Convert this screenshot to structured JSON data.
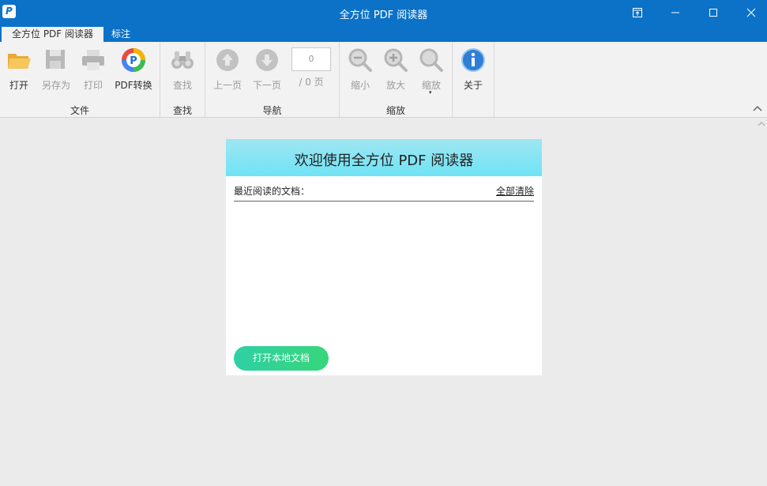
{
  "window": {
    "title": "全方位 PDF 阅读器",
    "icons": {
      "app": "pdf-reader-app-icon",
      "pin": "pin-icon",
      "minimize": "minimize-icon",
      "maximize": "maximize-icon",
      "close": "close-icon"
    }
  },
  "tabs": [
    {
      "label": "全方位 PDF 阅读器",
      "active": true
    },
    {
      "label": "标注",
      "active": false
    }
  ],
  "ribbon": {
    "groups": {
      "file": {
        "label": "文件",
        "buttons": [
          {
            "label": "打开",
            "icon": "folder-open-icon",
            "enabled": true
          },
          {
            "label": "另存为",
            "icon": "save-as-icon",
            "enabled": false
          },
          {
            "label": "打印",
            "icon": "printer-icon",
            "enabled": false
          },
          {
            "label": "PDF转换",
            "icon": "pdf-convert-icon",
            "enabled": true
          }
        ]
      },
      "find": {
        "label": "查找",
        "buttons": [
          {
            "label": "查找",
            "icon": "binoculars-icon",
            "enabled": false
          }
        ]
      },
      "nav": {
        "label": "导航",
        "buttons": [
          {
            "label": "上一页",
            "icon": "arrow-up-icon",
            "enabled": false
          },
          {
            "label": "下一页",
            "icon": "arrow-down-icon",
            "enabled": false
          }
        ],
        "page_input": "0",
        "page_total": "/ 0 页"
      },
      "zoom": {
        "label": "缩放",
        "buttons": [
          {
            "label": "缩小",
            "icon": "zoom-out-icon",
            "enabled": false
          },
          {
            "label": "放大",
            "icon": "zoom-in-icon",
            "enabled": false
          },
          {
            "label": "缩放",
            "icon": "zoom-icon",
            "enabled": false
          }
        ],
        "dropdown_arrow": "▾"
      },
      "about": {
        "buttons": [
          {
            "label": "关于",
            "icon": "info-icon",
            "enabled": true
          }
        ]
      }
    }
  },
  "welcome": {
    "title": "欢迎使用全方位 PDF 阅读器",
    "recent_label": "最近阅读的文档：",
    "clear_all": "全部清除",
    "recent_items": [],
    "open_button": "打开本地文档"
  },
  "colors": {
    "titlebar": "#0b72c7",
    "ribbon_bg": "#f2f2f2",
    "workspace_bg": "#ebebeb",
    "panel_header": "#7fe4f4",
    "open_button": "#33d38f"
  }
}
